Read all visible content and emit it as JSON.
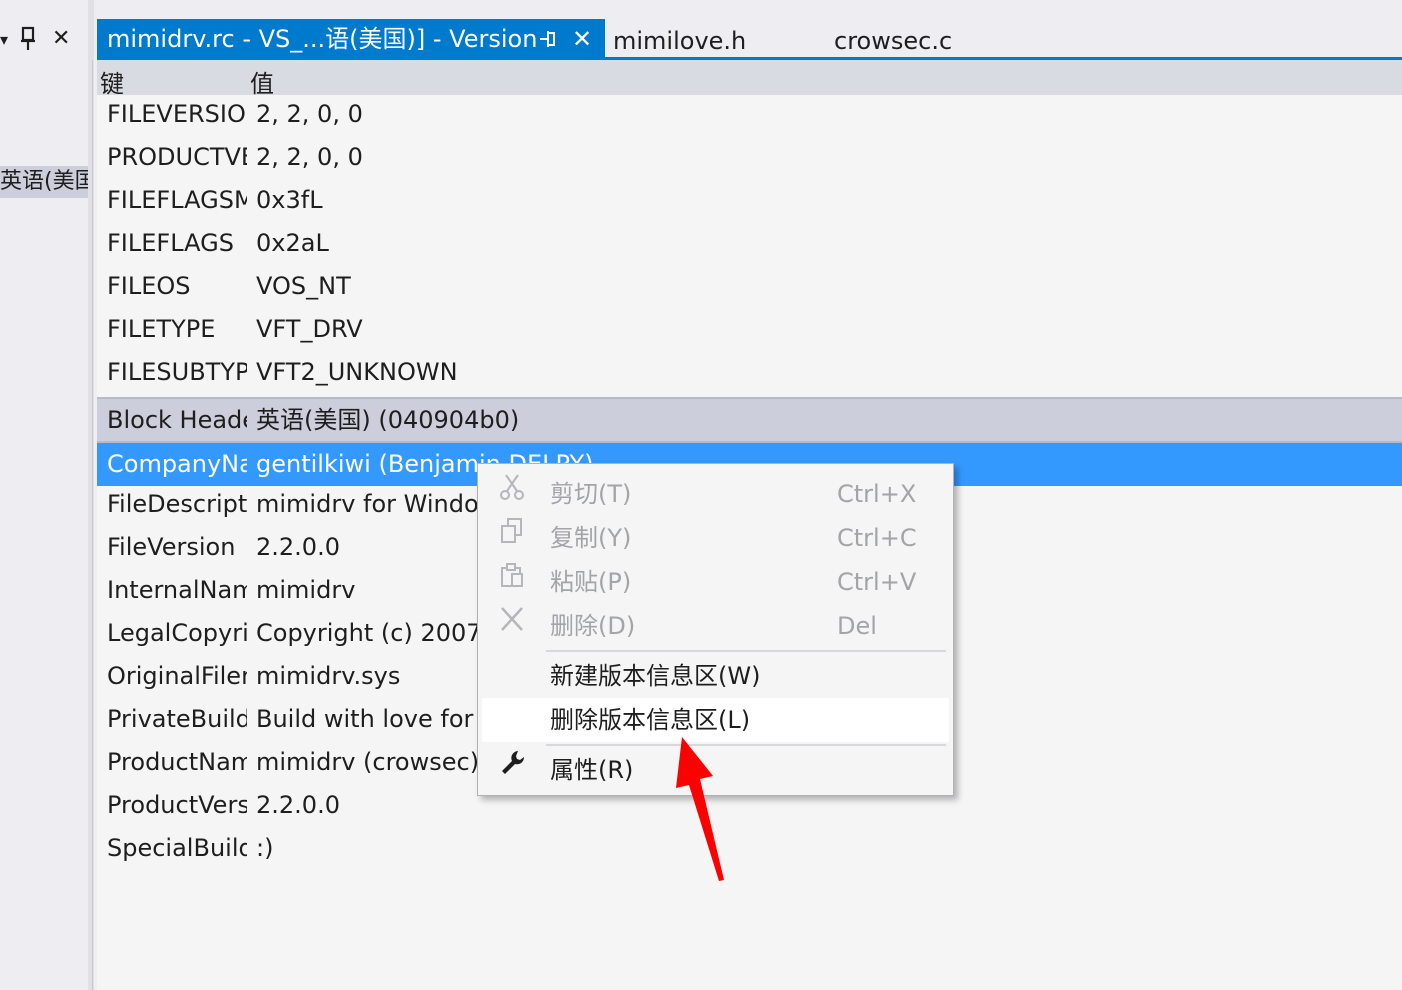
{
  "left_panel": {
    "dropdown_glyph": "▾",
    "pin_glyph": "🖈",
    "close_glyph": "✕",
    "tree_item_label": "英语(美国"
  },
  "tabs": {
    "active": {
      "label": "mimidrv.rc - VS_...语(美国)] - Version",
      "pin_glyph": "⊣",
      "close_glyph": "✕"
    },
    "inactive": [
      {
        "label": "mimilove.h"
      },
      {
        "label": "crowsec.c"
      }
    ]
  },
  "grid": {
    "header": {
      "key": "键",
      "value": "值"
    },
    "rows": [
      {
        "key": "FILEVERSION",
        "value": "2, 2, 0, 0"
      },
      {
        "key": "PRODUCTVERSION",
        "value": "2, 2, 0, 0"
      },
      {
        "key": "FILEFLAGSMASK",
        "value": "0x3fL"
      },
      {
        "key": "FILEFLAGS",
        "value": "0x2aL"
      },
      {
        "key": "FILEOS",
        "value": "VOS_NT"
      },
      {
        "key": "FILETYPE",
        "value": "VFT_DRV"
      },
      {
        "key": "FILESUBTYPE",
        "value": "VFT2_UNKNOWN"
      },
      {
        "key": "Block Header",
        "value": "英语(美国) (040904b0)"
      },
      {
        "key": "CompanyName",
        "value": "gentilkiwi (Benjamin DELPY)"
      },
      {
        "key": "FileDescription",
        "value": "mimidrv for Windows"
      },
      {
        "key": "FileVersion",
        "value": "2.2.0.0"
      },
      {
        "key": "InternalName",
        "value": "mimidrv"
      },
      {
        "key": "LegalCopyright",
        "value": "Copyright (c) 2007"
      },
      {
        "key": "OriginalFilename",
        "value": "mimidrv.sys"
      },
      {
        "key": "PrivateBuild",
        "value": "Build with love for POC"
      },
      {
        "key": "ProductName",
        "value": "mimidrv (crowsec)"
      },
      {
        "key": "ProductVersion",
        "value": "2.2.0.0"
      },
      {
        "key": "SpecialBuild",
        "value": ":)"
      }
    ]
  },
  "context_menu": {
    "items": [
      {
        "label": "剪切(T)",
        "shortcut": "Ctrl+X",
        "icon": "scissors-icon",
        "glyph": "✂",
        "enabled": false
      },
      {
        "label": "复制(Y)",
        "shortcut": "Ctrl+C",
        "icon": "copy-icon",
        "glyph": "⧉",
        "enabled": false
      },
      {
        "label": "粘贴(P)",
        "shortcut": "Ctrl+V",
        "icon": "paste-icon",
        "glyph": "📋",
        "enabled": false
      },
      {
        "label": "删除(D)",
        "shortcut": "Del",
        "icon": "delete-x-icon",
        "glyph": "✕",
        "enabled": false
      },
      {
        "label": "新建版本信息区(W)",
        "shortcut": "",
        "enabled": true
      },
      {
        "label": "删除版本信息区(L)",
        "shortcut": "",
        "enabled": true,
        "highlighted": true
      },
      {
        "label": "属性(R)",
        "shortcut": "",
        "icon": "wrench-icon",
        "glyph": "🔧",
        "enabled": true
      }
    ]
  },
  "colors": {
    "accent": "#007acc",
    "selection": "#3399ff",
    "arrow": "#ff0000"
  }
}
